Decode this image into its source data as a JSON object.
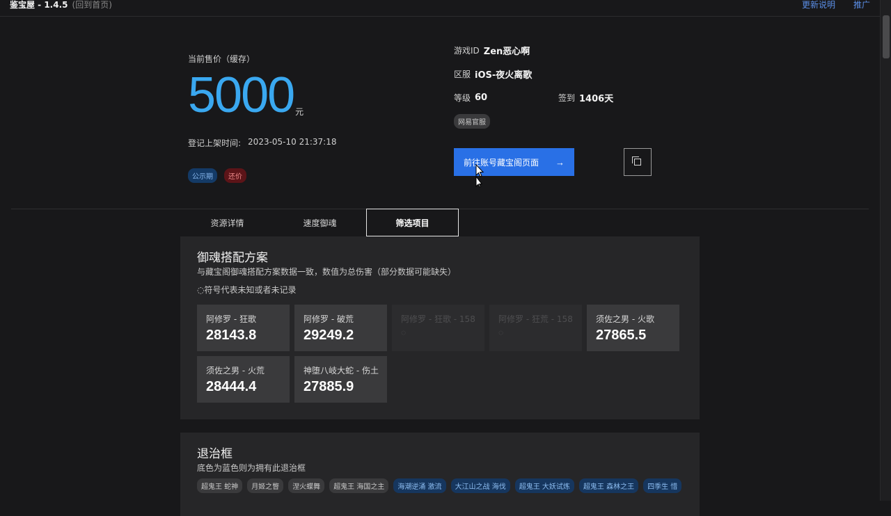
{
  "header": {
    "app_name": "鉴宝屋 - 1.4.5",
    "home_link": "(回到首页)",
    "links": [
      "更新说明",
      "推广"
    ]
  },
  "price": {
    "label": "当前售价（缓存）",
    "value": "5000",
    "unit": "元",
    "listed_label": "登记上架时间:",
    "listed_time": "2023-05-10 21:37:18",
    "badges": [
      "公示期",
      "还价"
    ]
  },
  "account": {
    "game_id_label": "游戏ID",
    "game_id": "Zen恶心啊",
    "server_label": "区服",
    "server": "iOS-夜火离歌",
    "level_label": "等级",
    "level": "60",
    "signin_label": "签到",
    "signin": "1406天",
    "official_tag": "网易官服",
    "go_button": "前往账号藏宝阁页面",
    "go_arrow": "→"
  },
  "tabs": [
    "资源详情",
    "速度御魂",
    "筛选项目"
  ],
  "active_tab": 2,
  "souls_card": {
    "title": "御魂搭配方案",
    "subtitle": "与藏宝阁御魂搭配方案数据一致，数值为总伤害（部分数据可能缺失）",
    "note": "◌符号代表未知或者未记录",
    "items": [
      {
        "name": "阿修罗 - 狂歌",
        "value": "28143.8",
        "dim": false
      },
      {
        "name": "阿修罗 - 破荒",
        "value": "29249.2",
        "dim": false
      },
      {
        "name": "阿修罗 - 狂歌 - 158",
        "value": "◌",
        "dim": true
      },
      {
        "name": "阿修罗 - 狂荒 - 158",
        "value": "◌",
        "dim": true
      },
      {
        "name": "须佐之男 - 火歌",
        "value": "27865.5",
        "dim": false
      },
      {
        "name": "须佐之男 - 火荒",
        "value": "28444.4",
        "dim": false
      },
      {
        "name": "神堕八岐大蛇 - 伤土",
        "value": "27885.9",
        "dim": false
      }
    ]
  },
  "boss_card": {
    "title": "退治框",
    "subtitle": "底色为蓝色则为拥有此退治框",
    "tags": [
      {
        "label": "超鬼王 蛇神",
        "owned": false
      },
      {
        "label": "月姬之瞥",
        "owned": false
      },
      {
        "label": "涅火蝶舞",
        "owned": false
      },
      {
        "label": "超鬼王 海国之主",
        "owned": false
      },
      {
        "label": "海潮逆涌 激流",
        "owned": true
      },
      {
        "label": "大江山之战 海伐",
        "owned": true
      },
      {
        "label": "超鬼王 大妖试炼",
        "owned": true
      },
      {
        "label": "超鬼王 森林之王",
        "owned": true
      },
      {
        "label": "四季生 惜",
        "owned": true
      }
    ]
  }
}
